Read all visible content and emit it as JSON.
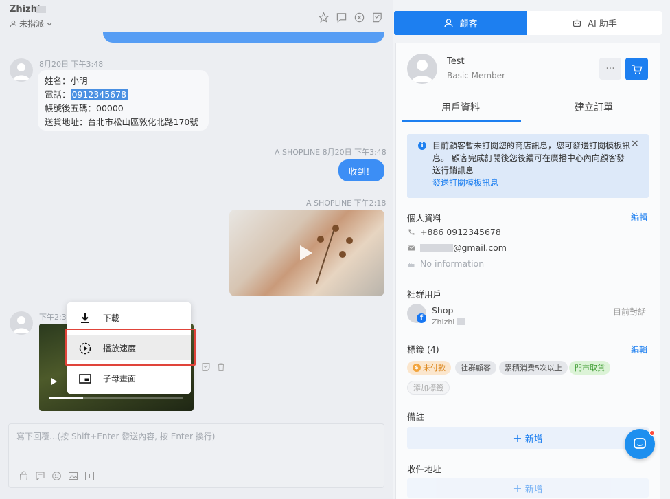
{
  "header": {
    "contact_name": "Zhizhi",
    "assign_label": "未指派",
    "icons": [
      "star-icon",
      "chat-icon",
      "close-circle-icon",
      "note-icon"
    ]
  },
  "messages": {
    "m1_time": "8月20日 下午3:48",
    "m1_line1": "姓名：小明",
    "m1_line2_prefix": "電話：",
    "m1_phone": "0912345678",
    "m1_line3": "帳號後五碼：00000",
    "m1_line4": "送貨地址：台北市松山區敦化北路170號",
    "m2_meta": "A SHOPLINE  8月20日 下午3:48",
    "m2_text": "收到！",
    "m3_meta": "A SHOPLINE  下午2:18",
    "m4_time": "下午2:38"
  },
  "context_menu": {
    "items": [
      {
        "label": "下載",
        "icon": "download-icon"
      },
      {
        "label": "播放速度",
        "icon": "playback-speed-icon"
      },
      {
        "label": "子母畫面",
        "icon": "picture-in-picture-icon"
      }
    ]
  },
  "composer": {
    "placeholder": "寫下回覆...(按 Shift+Enter 發送內容, 按 Enter 換行)"
  },
  "right_tabs": {
    "customer": "顧客",
    "ai": "AI 助手"
  },
  "customer": {
    "name": "Test",
    "tier": "Basic Member",
    "more": "···"
  },
  "subtabs": {
    "profile": "用戶資料",
    "order": "建立訂單"
  },
  "notice": {
    "text": "目前顧客暫未訂閱您的商店訊息，您可發送訂閱模板訊息。 顧客完成訂閱後您後續可在廣播中心內向顧客發送行銷訊息",
    "link": "發送訂閱模板訊息",
    "close": "×"
  },
  "personal": {
    "title": "個人資料",
    "edit": "編輯",
    "phone": "+886 0912345678",
    "email_suffix": "@gmail.com",
    "birthday": "No information"
  },
  "social": {
    "title": "社群用戶",
    "name": "Shop",
    "sub": "Zhizhi",
    "status": "目前對話"
  },
  "tags": {
    "title": "標籤 (4)",
    "edit": "編輯",
    "items": [
      "未付款",
      "社群顧客",
      "累積消費5次以上",
      "門市取貨"
    ],
    "add": "添加標籤"
  },
  "notes": {
    "title": "備註",
    "add": "新增"
  },
  "address": {
    "title": "收件地址",
    "add": "新增"
  },
  "colors": {
    "primary": "#1d7ff0",
    "highlight_border": "#e0443a"
  }
}
